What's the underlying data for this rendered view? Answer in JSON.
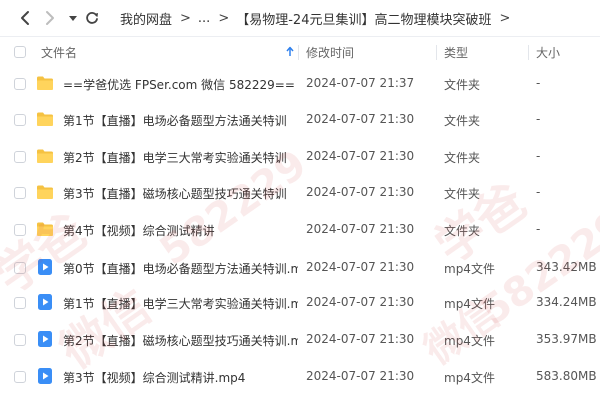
{
  "nav": {
    "back_icon": "chevron-left-icon",
    "forward_icon": "chevron-right-icon",
    "dropdown_icon": "caret-down-icon",
    "refresh_icon": "refresh-icon"
  },
  "breadcrumb": {
    "items": [
      "我的网盘",
      "...",
      "【易物理-24元旦集训】高二物理模块突破班"
    ],
    "separator": ">"
  },
  "columns": {
    "name": "文件名",
    "time": "修改时间",
    "type": "类型",
    "size": "大小",
    "sort_icon": "sort-up-arrow-icon"
  },
  "files": [
    {
      "icon": "folder-icon",
      "name": "==学爸优选 FPSer.com 微信 582229==",
      "time": "2024-07-07 21:37",
      "type": "文件夹",
      "size": "-"
    },
    {
      "icon": "folder-icon",
      "name": "第1节【直播】电场必备题型方法通关特训",
      "time": "2024-07-07 21:30",
      "type": "文件夹",
      "size": "-"
    },
    {
      "icon": "folder-icon",
      "name": "第2节【直播】电学三大常考实验通关特训",
      "time": "2024-07-07 21:30",
      "type": "文件夹",
      "size": "-"
    },
    {
      "icon": "folder-icon",
      "name": "第3节【直播】磁场核心题型技巧通关特训",
      "time": "2024-07-07 21:30",
      "type": "文件夹",
      "size": "-"
    },
    {
      "icon": "folder-icon",
      "name": "第4节【视频】综合测试精讲",
      "time": "2024-07-07 21:30",
      "type": "文件夹",
      "size": "-"
    },
    {
      "icon": "video-file-icon",
      "name": "第0节【直播】电场必备题型方法通关特训.m...",
      "time": "2024-07-07 21:30",
      "type": "mp4文件",
      "size": "343.42MB"
    },
    {
      "icon": "video-file-icon",
      "name": "第1节【直播】电学三大常考实验通关特训.m...",
      "time": "2024-07-07 21:30",
      "type": "mp4文件",
      "size": "334.24MB"
    },
    {
      "icon": "video-file-icon",
      "name": "第2节【直播】磁场核心题型技巧通关特训.m...",
      "time": "2024-07-07 21:30",
      "type": "mp4文件",
      "size": "353.97MB"
    },
    {
      "icon": "video-file-icon",
      "name": "第3节【视频】综合测试精讲.mp4",
      "time": "2024-07-07 21:30",
      "type": "mp4文件",
      "size": "583.80MB"
    }
  ],
  "watermark": {
    "texts": [
      "学爸",
      "微信",
      "582229"
    ]
  },
  "colors": {
    "folder": "#F5C242",
    "video": "#3A8EF6",
    "sort_arrow": "#2F80ED",
    "watermark": "#D23C3C"
  }
}
